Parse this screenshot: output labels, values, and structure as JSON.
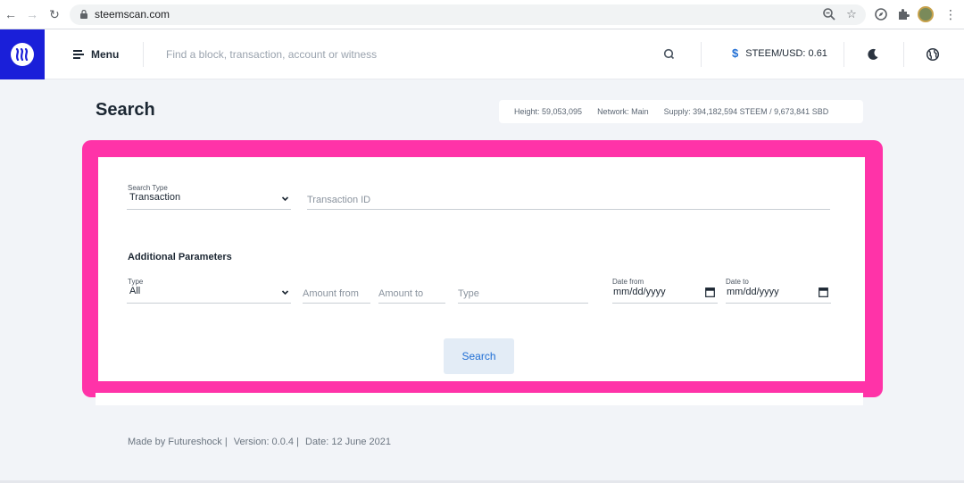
{
  "browser": {
    "url": "steemscan.com"
  },
  "header": {
    "menu_label": "Menu",
    "search_placeholder": "Find a block, transaction, account or witness",
    "price_label": "STEEM/USD: 0.61",
    "price_symbol": "$"
  },
  "page": {
    "title": "Search"
  },
  "stats": {
    "height": "Height: 59,053,095",
    "network": "Network: Main",
    "supply": "Supply: 394,182,594 STEEM / 9,673,841 SBD"
  },
  "search_form": {
    "search_type_label": "Search Type",
    "search_type_value": "Transaction",
    "id_placeholder": "Transaction ID",
    "additional_title": "Additional Parameters",
    "type_label": "Type",
    "type_value": "All",
    "amount_from_placeholder": "Amount from",
    "amount_to_placeholder": "Amount to",
    "op_type_placeholder": "Type",
    "date_from_label": "Date from",
    "date_from_value": "mm/dd/yyyy",
    "date_to_label": "Date to",
    "date_to_value": "mm/dd/yyyy",
    "submit_label": "Search"
  },
  "footer": {
    "made_by": "Made by Futureshock |",
    "version": "Version: 0.0.4 |",
    "date": "Date: 12 June 2021"
  },
  "colors": {
    "brand": "#1a1fd9",
    "highlight": "#ff33a8",
    "accent": "#1f6ed4"
  }
}
